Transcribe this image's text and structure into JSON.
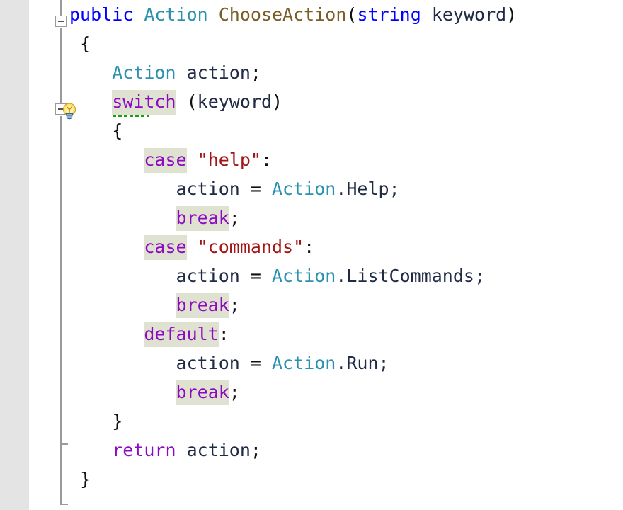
{
  "editor": {
    "language": "csharp",
    "font_size_px": 25,
    "line_height_px": 41,
    "background_color": "#ffffff",
    "indicator_margin_color": "#e4e4e4",
    "fold_line_color": "#9a9a9a",
    "highlight_color": "#dfe2d0",
    "squiggle_color": "#17a00e"
  },
  "gutter": {
    "quick_action_icon": "lightbulb-icon",
    "quick_action_line": 4,
    "fold_markers": [
      {
        "name": "fold-marker-method",
        "line": 1,
        "state": "expanded",
        "glyph": "minus"
      },
      {
        "name": "fold-marker-switch",
        "line": 4,
        "state": "expanded",
        "glyph": "minus"
      }
    ]
  },
  "colors": {
    "keyword": "#0000ff",
    "type": "#2b91af",
    "method": "#795e26",
    "identifier": "#1f2a44",
    "punctuation": "#101010",
    "control_keyword": "#8f08c4",
    "string_literal": "#a31515"
  },
  "code": {
    "lines": [
      {
        "n": 1,
        "indent": 0,
        "tokens": [
          {
            "text": "public",
            "kind": "keyword"
          },
          {
            "text": " ",
            "kind": "space"
          },
          {
            "text": "Action",
            "kind": "type"
          },
          {
            "text": " ",
            "kind": "space"
          },
          {
            "text": "ChooseAction",
            "kind": "method"
          },
          {
            "text": "(",
            "kind": "punct"
          },
          {
            "text": "string",
            "kind": "keyword"
          },
          {
            "text": " ",
            "kind": "space"
          },
          {
            "text": "keyword",
            "kind": "identifier"
          },
          {
            "text": ")",
            "kind": "punct"
          }
        ]
      },
      {
        "n": 2,
        "indent": 1,
        "tokens": [
          {
            "text": "{",
            "kind": "punct"
          }
        ]
      },
      {
        "n": 3,
        "indent": 4,
        "tokens": [
          {
            "text": "Action",
            "kind": "type"
          },
          {
            "text": " ",
            "kind": "space"
          },
          {
            "text": "action",
            "kind": "identifier"
          },
          {
            "text": ";",
            "kind": "punct"
          }
        ]
      },
      {
        "n": 4,
        "indent": 4,
        "tokens": [
          {
            "text": "switch",
            "kind": "control",
            "highlight": true,
            "squiggle": true
          },
          {
            "text": " ",
            "kind": "space"
          },
          {
            "text": "(",
            "kind": "punct"
          },
          {
            "text": "keyword",
            "kind": "identifier"
          },
          {
            "text": ")",
            "kind": "punct"
          }
        ]
      },
      {
        "n": 5,
        "indent": 4,
        "tokens": [
          {
            "text": "{",
            "kind": "punct"
          }
        ]
      },
      {
        "n": 6,
        "indent": 7,
        "tokens": [
          {
            "text": "case",
            "kind": "control",
            "highlight": true
          },
          {
            "text": " ",
            "kind": "space"
          },
          {
            "text": "\"help\"",
            "kind": "string"
          },
          {
            "text": ":",
            "kind": "punct"
          }
        ]
      },
      {
        "n": 7,
        "indent": 10,
        "tokens": [
          {
            "text": "action",
            "kind": "identifier"
          },
          {
            "text": " = ",
            "kind": "punct"
          },
          {
            "text": "Action",
            "kind": "type"
          },
          {
            "text": ".Help;",
            "kind": "identifier"
          }
        ]
      },
      {
        "n": 8,
        "indent": 10,
        "tokens": [
          {
            "text": "break",
            "kind": "control",
            "highlight": true
          },
          {
            "text": ";",
            "kind": "punct"
          }
        ]
      },
      {
        "n": 9,
        "indent": 7,
        "tokens": [
          {
            "text": "case",
            "kind": "control",
            "highlight": true
          },
          {
            "text": " ",
            "kind": "space"
          },
          {
            "text": "\"commands\"",
            "kind": "string"
          },
          {
            "text": ":",
            "kind": "punct"
          }
        ]
      },
      {
        "n": 10,
        "indent": 10,
        "tokens": [
          {
            "text": "action",
            "kind": "identifier"
          },
          {
            "text": " = ",
            "kind": "punct"
          },
          {
            "text": "Action",
            "kind": "type"
          },
          {
            "text": ".ListCommands;",
            "kind": "identifier"
          }
        ]
      },
      {
        "n": 11,
        "indent": 10,
        "tokens": [
          {
            "text": "break",
            "kind": "control",
            "highlight": true
          },
          {
            "text": ";",
            "kind": "punct"
          }
        ]
      },
      {
        "n": 12,
        "indent": 7,
        "tokens": [
          {
            "text": "default",
            "kind": "control",
            "highlight": true
          },
          {
            "text": ":",
            "kind": "punct"
          }
        ]
      },
      {
        "n": 13,
        "indent": 10,
        "tokens": [
          {
            "text": "action",
            "kind": "identifier"
          },
          {
            "text": " = ",
            "kind": "punct"
          },
          {
            "text": "Action",
            "kind": "type"
          },
          {
            "text": ".Run;",
            "kind": "identifier"
          }
        ]
      },
      {
        "n": 14,
        "indent": 10,
        "tokens": [
          {
            "text": "break",
            "kind": "control",
            "highlight": true
          },
          {
            "text": ";",
            "kind": "punct"
          }
        ]
      },
      {
        "n": 15,
        "indent": 4,
        "tokens": [
          {
            "text": "}",
            "kind": "punct"
          }
        ]
      },
      {
        "n": 16,
        "indent": 4,
        "tokens": [
          {
            "text": "return",
            "kind": "control"
          },
          {
            "text": " ",
            "kind": "space"
          },
          {
            "text": "action",
            "kind": "identifier"
          },
          {
            "text": ";",
            "kind": "punct"
          }
        ]
      },
      {
        "n": 17,
        "indent": 1,
        "tokens": [
          {
            "text": "}",
            "kind": "punct"
          }
        ]
      }
    ]
  }
}
